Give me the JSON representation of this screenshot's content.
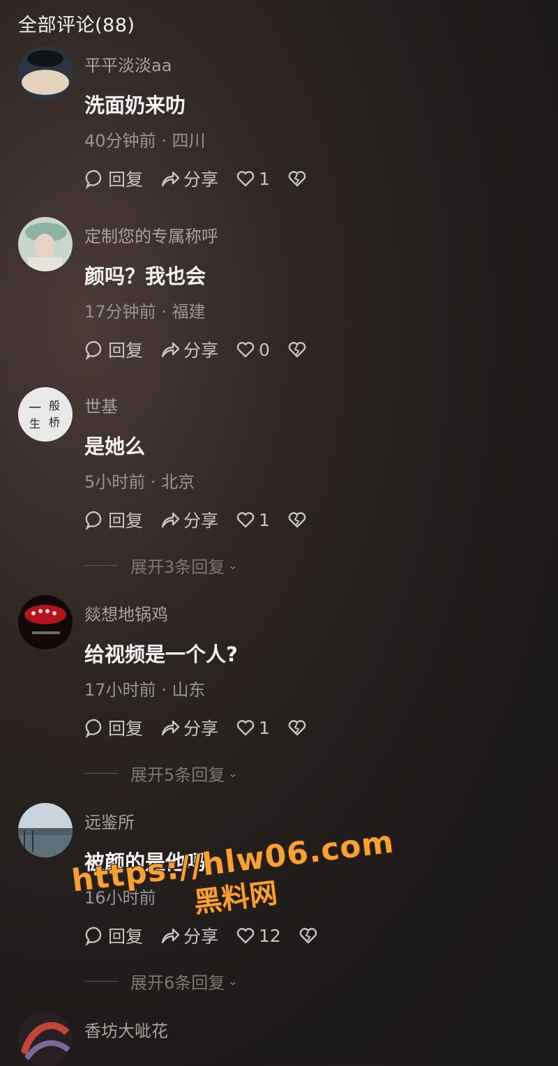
{
  "header": {
    "title": "全部评论(88)"
  },
  "labels": {
    "reply": "回复",
    "share": "分享"
  },
  "comments": [
    {
      "username": "平平淡淡aa",
      "text": "洗面奶来叻",
      "time": "40分钟前",
      "location": "四川",
      "likes": "1",
      "expand": ""
    },
    {
      "username": "定制您的专属称呼",
      "text": "颜吗？我也会",
      "time": "17分钟前",
      "location": "福建",
      "likes": "0",
      "expand": ""
    },
    {
      "username": "世基",
      "text": "是她么",
      "time": "5小时前",
      "location": "北京",
      "likes": "1",
      "expand": "展开3条回复"
    },
    {
      "username": "燚想地锅鸡",
      "text": "给视频是一个人?",
      "time": "17小时前",
      "location": "山东",
      "likes": "1",
      "expand": "展开5条回复"
    },
    {
      "username": "远鉴所",
      "text": "被颜的是他吗",
      "time": "16小时前",
      "location": "",
      "likes": "12",
      "expand": "展开6条回复"
    },
    {
      "username": "香坊大呲花",
      "text": "",
      "time": "",
      "location": "",
      "likes": "",
      "expand": ""
    }
  ],
  "avatar_art": {
    "c0": "一",
    "c1": "般",
    "c2": "生",
    "c3": "桥"
  },
  "watermark": {
    "url": "https://hlw06.com",
    "name": "黑料网"
  },
  "icons": {
    "reply": "comment-bubble-icon",
    "share": "share-arrow-icon",
    "like": "heart-icon",
    "dislike": "broken-heart-icon"
  },
  "colors": {
    "accent_watermark": "#f2a23c",
    "text_primary": "#f4f4f4",
    "text_secondary": "#a8a2a0"
  }
}
